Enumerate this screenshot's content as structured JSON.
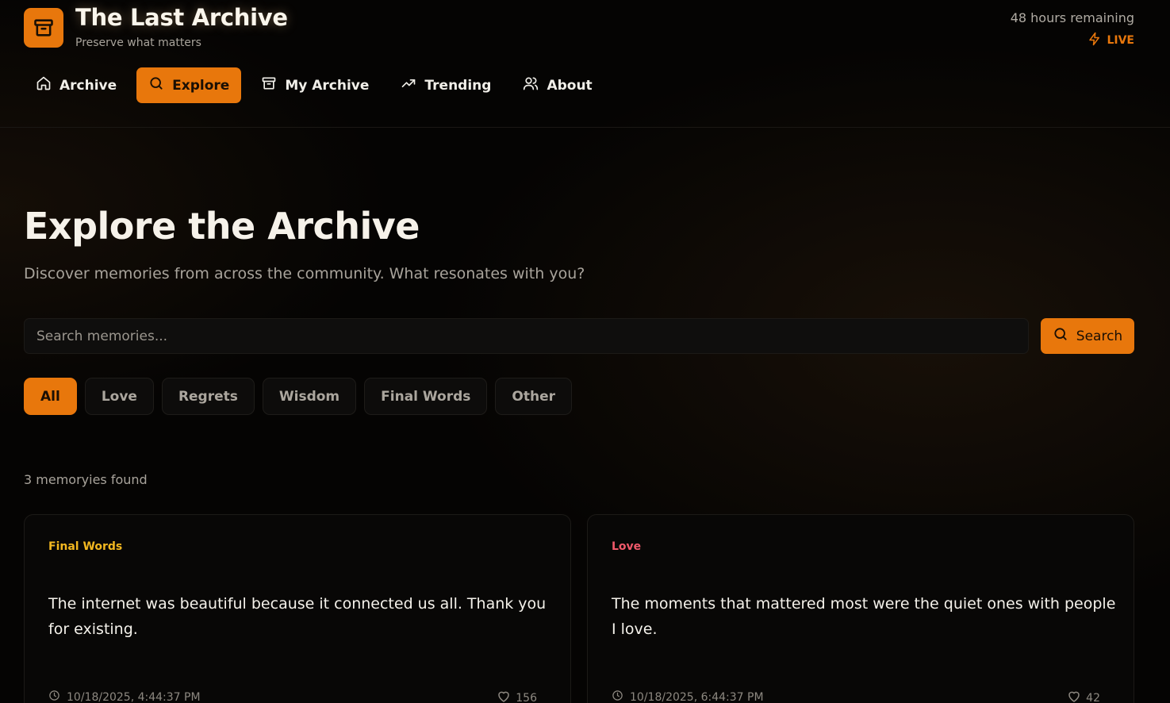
{
  "colors": {
    "accent": "#e8770c",
    "final_words": "#f2b720",
    "love": "#f0596a"
  },
  "brand": {
    "title": "The Last Archive",
    "tagline": "Preserve what matters",
    "icon": "archive-box-icon"
  },
  "status": {
    "timer": "48 hours remaining",
    "live_label": "LIVE",
    "live_icon": "lightning-icon"
  },
  "nav": {
    "items": [
      {
        "label": "Archive",
        "icon": "home-icon"
      },
      {
        "label": "Explore",
        "icon": "search-icon",
        "active": true
      },
      {
        "label": "My Archive",
        "icon": "archive-box-icon"
      },
      {
        "label": "Trending",
        "icon": "trending-up-icon"
      },
      {
        "label": "About",
        "icon": "users-icon"
      }
    ]
  },
  "main": {
    "title": "Explore the Archive",
    "subtitle": "Discover memories from across the community. What resonates with you?",
    "search": {
      "placeholder": "Search memories...",
      "value": "",
      "button_label": "Search"
    },
    "filters": [
      "All",
      "Love",
      "Regrets",
      "Wisdom",
      "Final Words",
      "Other"
    ],
    "active_filter": "All",
    "result_count": "3 memoryies found",
    "cards": [
      {
        "category": "Final Words",
        "text": "The internet was beautiful because it connected us all. Thank you for existing.",
        "timestamp": "10/18/2025, 4:44:37 PM",
        "likes": "156"
      },
      {
        "category": "Love",
        "text": "The moments that mattered most were the quiet ones with people I love.",
        "timestamp": "10/18/2025, 6:44:37 PM",
        "likes": "42"
      }
    ]
  }
}
